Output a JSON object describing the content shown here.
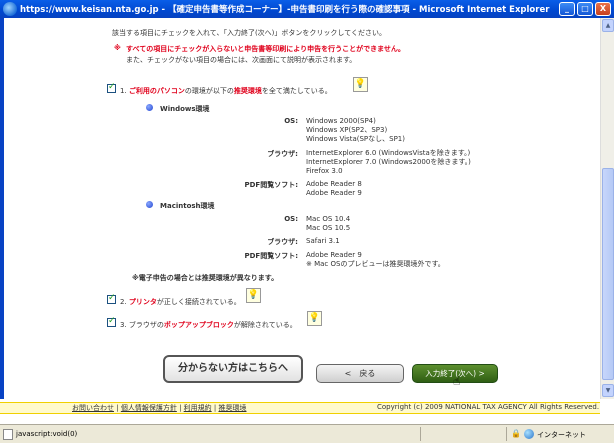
{
  "window": {
    "title": "https://www.keisan.nta.go.jp - 【確定申告書等作成コーナー】-申告書印刷を行う際の確認事項 - Microsoft Internet Explorer",
    "controls": {
      "minimize": "_",
      "maximize": "□",
      "close": "X"
    }
  },
  "instructions": {
    "line1": "該当する項目にチェックを入れて、「入力終了(次へ)」ボタンをクリックしてください。",
    "warning_mark": "※",
    "warning": "すべての項目にチェックが入らないと申告書等印刷により申告を行うことができません。",
    "note": "また、チェックがない項目の場合には、次画面にて説明が表示されます。"
  },
  "item1": {
    "num": "1.",
    "pre": "ご利用のパソコン",
    "mid": "の環境が以下の",
    "emph": "推奨環境",
    "post": "を全て満たしている。"
  },
  "windows": {
    "heading": "Windows環境",
    "os_label": "OS:",
    "os": [
      "Windows 2000(SP4)",
      "Windows XP(SP2、SP3)",
      "Windows Vista(SPなし、SP1)"
    ],
    "browser_label": "ブラウザ:",
    "browser": [
      "InternetExplorer 6.0 (WindowsVistaを除きます。)",
      "InternetExplorer 7.0 (Windows2000を除きます。)",
      "Firefox 3.0"
    ],
    "pdf_label": "PDF閲覧ソフト:",
    "pdf": [
      "Adobe Reader 8",
      "Adobe Reader 9"
    ]
  },
  "mac": {
    "heading": "Macintosh環境",
    "os_label": "OS:",
    "os": [
      "Mac OS 10.4",
      "Mac OS 10.5"
    ],
    "browser_label": "ブラウザ:",
    "browser": [
      "Safari 3.1"
    ],
    "pdf_label": "PDF閲覧ソフト:",
    "pdf": [
      "Adobe Reader 9",
      "※ Mac OSのプレビューは推奨環境外です。"
    ]
  },
  "e_tax_note": "※電子申告の場合とは推奨環境が異なります。",
  "item2": {
    "num": "2.",
    "emph": "プリンタ",
    "post": "が正しく接続されている。"
  },
  "item3": {
    "num": "3.",
    "pre": "ブラウザの",
    "emph": "ポップアップブロック",
    "post": "が解除されている。"
  },
  "buttons": {
    "help": "分からない方はこちらへ",
    "back": "<　戻る",
    "next": "入力終了(次へ) >"
  },
  "footer": {
    "links": [
      "お問い合わせ",
      "個人情報保護方針",
      "利用規約",
      "推奨環境"
    ],
    "separator": "|",
    "copyright": "Copyright (c) 2009 NATIONAL TAX AGENCY All Rights Reserved."
  },
  "status": {
    "text": "javascript:void(0)",
    "zone": "インターネット"
  },
  "colors": {
    "accent_red": "#e0001b",
    "next_button": "#3b6e1d",
    "titlebar": "#0a5ee8"
  }
}
